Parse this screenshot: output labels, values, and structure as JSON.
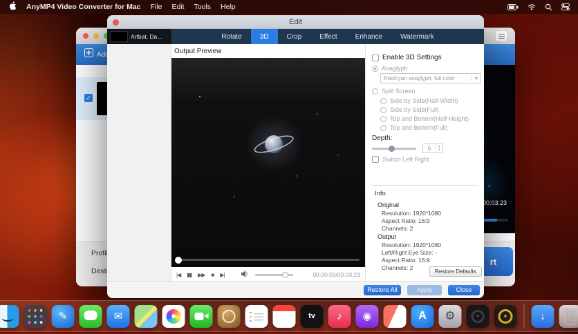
{
  "menu_bar": {
    "app_name": "AnyMP4 Video Converter for Mac",
    "menus": [
      "File",
      "Edit",
      "Tools",
      "Help"
    ]
  },
  "main_window": {
    "add_button_label": "Add F",
    "clip_time": "00:03:23",
    "profile_label": "Profile:",
    "destination_label": "Destination",
    "convert_button_visible_text": "rt"
  },
  "edit_window": {
    "title": "Edit",
    "sidebar_item_label": "Artbat, Da...",
    "tabs": [
      "Rotate",
      "3D",
      "Crop",
      "Effect",
      "Enhance",
      "Watermark"
    ],
    "active_tab": "3D",
    "output_preview_label": "Output Preview",
    "time_display": "00:00:03/00:03:23",
    "settings": {
      "enable_3d_label": "Enable 3D Settings",
      "anaglyph_label": "Anaglyph",
      "anaglyph_value": "Red/cyan anaglyph, full color",
      "split_screen_label": "Split Screen",
      "split_options": [
        "Side by Side(Half-Width)",
        "Side by Side(Full)",
        "Top and Bottom(Half-Height)",
        "Top and Bottom(Full)"
      ],
      "depth_label": "Depth:",
      "depth_value": "6",
      "switch_label": "Switch Left Right",
      "info_title": "Info",
      "original_title": "Original",
      "original_lines": [
        "Resolution: 1920*1080",
        "Aspect Ratio: 16:9",
        "Channels: 2"
      ],
      "output_title": "Output",
      "output_lines": [
        "Resolution: 1920*1080",
        "Left/Right Eye Size: -",
        "Aspect Ratio: 16:9",
        "Channels: 2"
      ],
      "restore_defaults_label": "Restore Defaults"
    },
    "footer": {
      "restore_all": "Restore All",
      "apply": "Apply",
      "close": "Close"
    }
  },
  "icons": {
    "prev": "|◀",
    "pause": "▮▮",
    "forward": "▶▶",
    "stop": "■",
    "next": "▶|",
    "check": "✓",
    "caret_down": "▾",
    "caret_up": "▴",
    "pen": "✎",
    "mail": "✉",
    "music": "♪",
    "podcasts": "◉",
    "settings": "⚙",
    "apple_tv": "tv",
    "app_store": "A",
    "downloads": "↓"
  },
  "dock": {
    "items": [
      "finder",
      "launchpad",
      "markup",
      "messages",
      "mail",
      "maps",
      "photos",
      "facetime",
      "clock",
      "reminders",
      "calendar",
      "apple-tv",
      "music",
      "podcasts",
      "news",
      "app-store",
      "system-settings",
      "disc-utility",
      "video-converter",
      "downloads",
      "trash"
    ]
  },
  "colors": {
    "accent_blue": "#2c7de0",
    "tab_bar": "#20364e",
    "toolbar_blue": "#2f7cd0"
  }
}
